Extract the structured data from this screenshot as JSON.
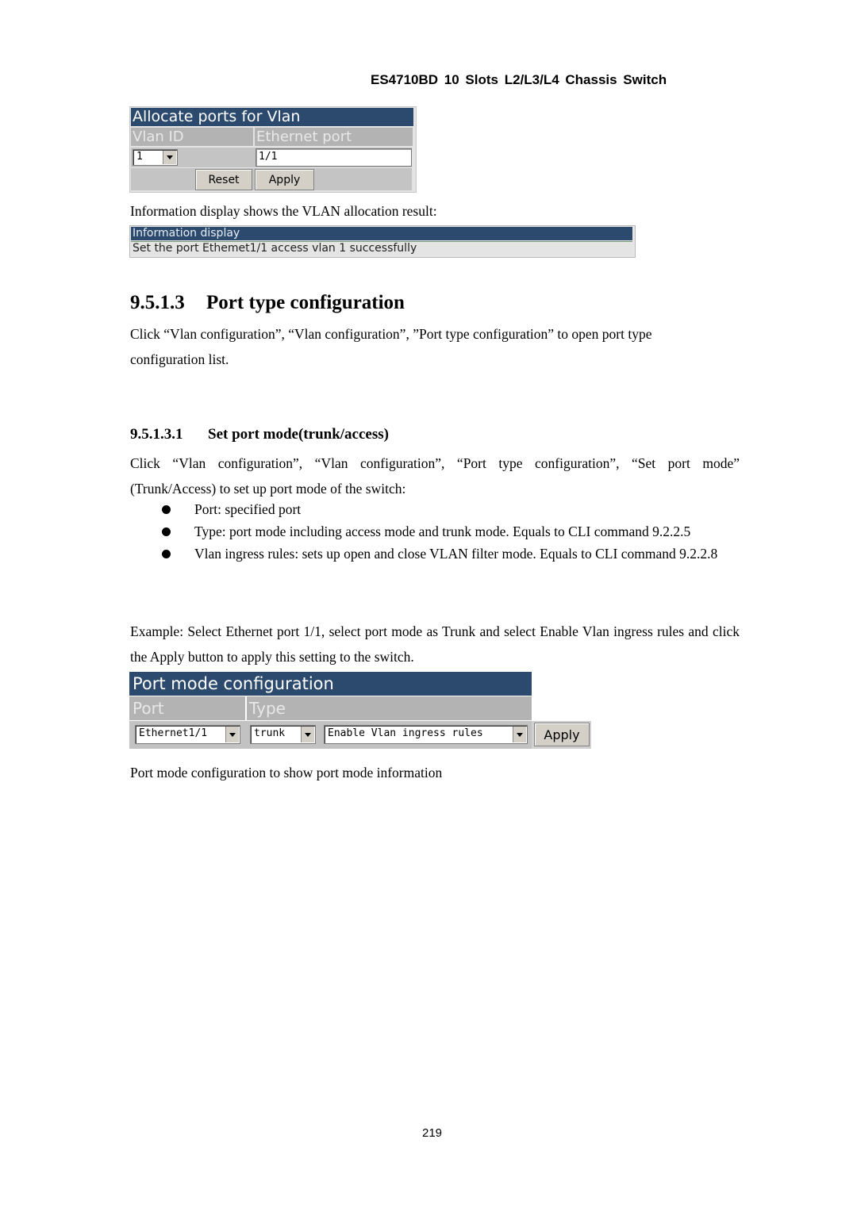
{
  "header": {
    "title": "ES4710BD 10 Slots L2/L3/L4 Chassis Switch"
  },
  "allocate_panel": {
    "title": "Allocate ports for Vlan",
    "col_vlan_id": "Vlan ID",
    "col_ethernet_port": "Ethernet port",
    "vlan_id_value": "1",
    "ethernet_port_value": "1/1",
    "reset_label": "Reset",
    "apply_label": "Apply"
  },
  "info_intro": "Information display shows the VLAN allocation result:",
  "info_panel": {
    "title": "Information display",
    "message": "Set the port Ethemet1/1 access vlan 1 successfully"
  },
  "section": {
    "number": "9.5.1.3",
    "title": "Port type configuration",
    "intro_line1": "Click “Vlan configuration”, “Vlan configuration”, ”Port type configuration” to open port type",
    "intro_line2": "configuration list."
  },
  "subsection": {
    "number": "9.5.1.3.1",
    "title": "Set port mode(trunk/access)",
    "intro": "Click “Vlan configuration”, “Vlan configuration”, “Port type configuration”, “Set port mode” (Trunk/Access) to set up port mode of the switch:",
    "bullets": [
      "Port: specified port",
      "Type: port mode including access mode and trunk mode. Equals to CLI command 9.2.2.5",
      "Vlan ingress rules: sets up open and close VLAN filter mode. Equals to CLI command 9.2.2.8"
    ],
    "example": "Example: Select Ethernet port 1/1, select port mode as Trunk and select Enable Vlan ingress rules and click the Apply button to apply this setting to the switch."
  },
  "port_mode_panel": {
    "title": "Port mode configuration",
    "col_port": "Port",
    "col_type": "Type",
    "port_value": "Ethernet1/1",
    "type_value": "trunk",
    "ingress_value": "Enable Vlan ingress rules",
    "apply_label": "Apply"
  },
  "caption": "Port mode configuration to show port mode information",
  "page_number": "219"
}
